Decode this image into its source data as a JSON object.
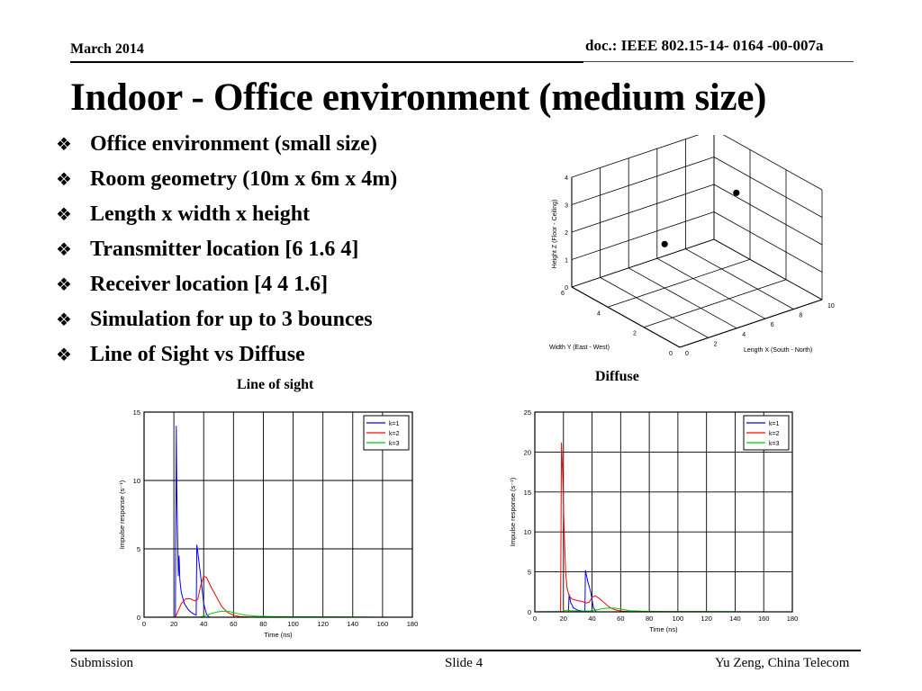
{
  "header": {
    "date": "March 2014",
    "doc_id": "doc.: IEEE 802.15-14- 0164 -00-007a"
  },
  "slide_title": "Indoor - Office environment (medium size)",
  "bullets": [
    "Office environment (small size)",
    "Room geometry (10m x 6m x 4m)",
    "Length x width x height",
    "Transmitter location [6 1.6 4]",
    "Receiver location [4 4 1.6]",
    "Simulation for up to 3 bounces",
    "Line of Sight vs Diffuse"
  ],
  "bullet_icon": "diamond-cluster-bullet-icon",
  "footer": {
    "left": "Submission",
    "center": "Slide 4",
    "right": "Yu Zeng, China Telecom"
  },
  "chart_data": [
    {
      "type": "scatter",
      "subtype": "3d",
      "title": "",
      "xlabel": "Length X (South - North)",
      "ylabel": "Width Y (East - West)",
      "zlabel": "Height Z (Floor - Ceiling)",
      "xlim": [
        0,
        10
      ],
      "ylim": [
        0,
        6
      ],
      "zlim": [
        0,
        4
      ],
      "xticks": [
        0,
        2,
        4,
        6,
        8,
        10
      ],
      "yticks": [
        0,
        2,
        4,
        6
      ],
      "zticks": [
        0,
        1,
        2,
        3,
        4
      ],
      "grid": true,
      "points": [
        {
          "name": "Transmitter",
          "x": 6,
          "y": 1.6,
          "z": 4
        },
        {
          "name": "Receiver",
          "x": 4,
          "y": 4,
          "z": 1.6
        }
      ]
    },
    {
      "type": "line",
      "title": "Line of sight",
      "xlabel": "Time (ns)",
      "ylabel": "Impulse response (s⁻¹)",
      "xlim": [
        0,
        180
      ],
      "ylim": [
        0,
        15
      ],
      "xticks": [
        0,
        20,
        40,
        60,
        80,
        100,
        120,
        140,
        160,
        180
      ],
      "yticks": [
        0,
        5,
        10,
        15
      ],
      "grid": true,
      "legend": "top-right",
      "series": [
        {
          "name": "k=1",
          "color": "#0000ff",
          "x": [
            0,
            20,
            21,
            21.6,
            22,
            23,
            23.5,
            24,
            24.5,
            25,
            27,
            30,
            33,
            35,
            35.4,
            36,
            38,
            40,
            42,
            44,
            180
          ],
          "y": [
            0,
            0,
            0,
            14,
            9,
            3,
            4.5,
            2.8,
            2.2,
            1.8,
            1.0,
            0.5,
            0.25,
            0.15,
            5.3,
            4.8,
            3.0,
            1.0,
            0.2,
            0,
            0
          ]
        },
        {
          "name": "k=2",
          "color": "#ff0000",
          "x": [
            0,
            21,
            23,
            25,
            28,
            31,
            34,
            36,
            38,
            40,
            42,
            45,
            48,
            52,
            56,
            60,
            64,
            70,
            80,
            180
          ],
          "y": [
            0,
            0,
            0.5,
            1.0,
            1.35,
            1.35,
            1.2,
            1.3,
            2.3,
            3.0,
            2.9,
            2.2,
            1.6,
            0.8,
            0.35,
            0.15,
            0.05,
            0.02,
            0,
            0
          ]
        },
        {
          "name": "k=3",
          "color": "#00cc00",
          "x": [
            0,
            38,
            42,
            46,
            50,
            54,
            58,
            62,
            68,
            75,
            85,
            100,
            120,
            165,
            180
          ],
          "y": [
            0,
            0.02,
            0.15,
            0.3,
            0.4,
            0.45,
            0.4,
            0.28,
            0.15,
            0.08,
            0.05,
            0.04,
            0.03,
            0,
            0
          ]
        }
      ]
    },
    {
      "type": "line",
      "title": "Diffuse",
      "xlabel": "Time (ns)",
      "ylabel": "Impulse response (s⁻¹)",
      "xlim": [
        0,
        180
      ],
      "ylim": [
        0,
        25
      ],
      "xticks": [
        0,
        20,
        40,
        60,
        80,
        100,
        120,
        140,
        160,
        180
      ],
      "yticks": [
        0,
        5,
        10,
        15,
        20,
        25
      ],
      "grid": true,
      "legend": "top-right",
      "series": [
        {
          "name": "k=1",
          "color": "#0000ff",
          "x": [
            0,
            23.5,
            24,
            25,
            27,
            30,
            33,
            35,
            35.4,
            37,
            39,
            41,
            43,
            180
          ],
          "y": [
            0,
            0,
            2.2,
            1.2,
            0.5,
            0.2,
            0.1,
            0.05,
            5.2,
            3.8,
            2.5,
            0.5,
            0,
            0
          ]
        },
        {
          "name": "k=2",
          "color": "#ff0000",
          "x": [
            0,
            18,
            18.6,
            19.5,
            20.5,
            21.5,
            22.5,
            24,
            26,
            30,
            33,
            36,
            38,
            40,
            42,
            45,
            48,
            52,
            56,
            60,
            65,
            70,
            180
          ],
          "y": [
            0,
            0,
            21.2,
            17,
            10,
            5,
            3,
            2.0,
            1.6,
            1.4,
            1.3,
            1.1,
            1.2,
            1.8,
            2.0,
            1.7,
            1.2,
            0.6,
            0.25,
            0.1,
            0.05,
            0,
            0
          ]
        },
        {
          "name": "k=3",
          "color": "#00cc00",
          "x": [
            0,
            20,
            22,
            25,
            30,
            38,
            42,
            46,
            50,
            54,
            58,
            62,
            66,
            75,
            90,
            120,
            165,
            180
          ],
          "y": [
            0,
            0.05,
            0.2,
            0.15,
            0.1,
            0.1,
            0.2,
            0.35,
            0.45,
            0.48,
            0.4,
            0.28,
            0.15,
            0.08,
            0.05,
            0.04,
            0,
            0
          ]
        }
      ]
    }
  ]
}
